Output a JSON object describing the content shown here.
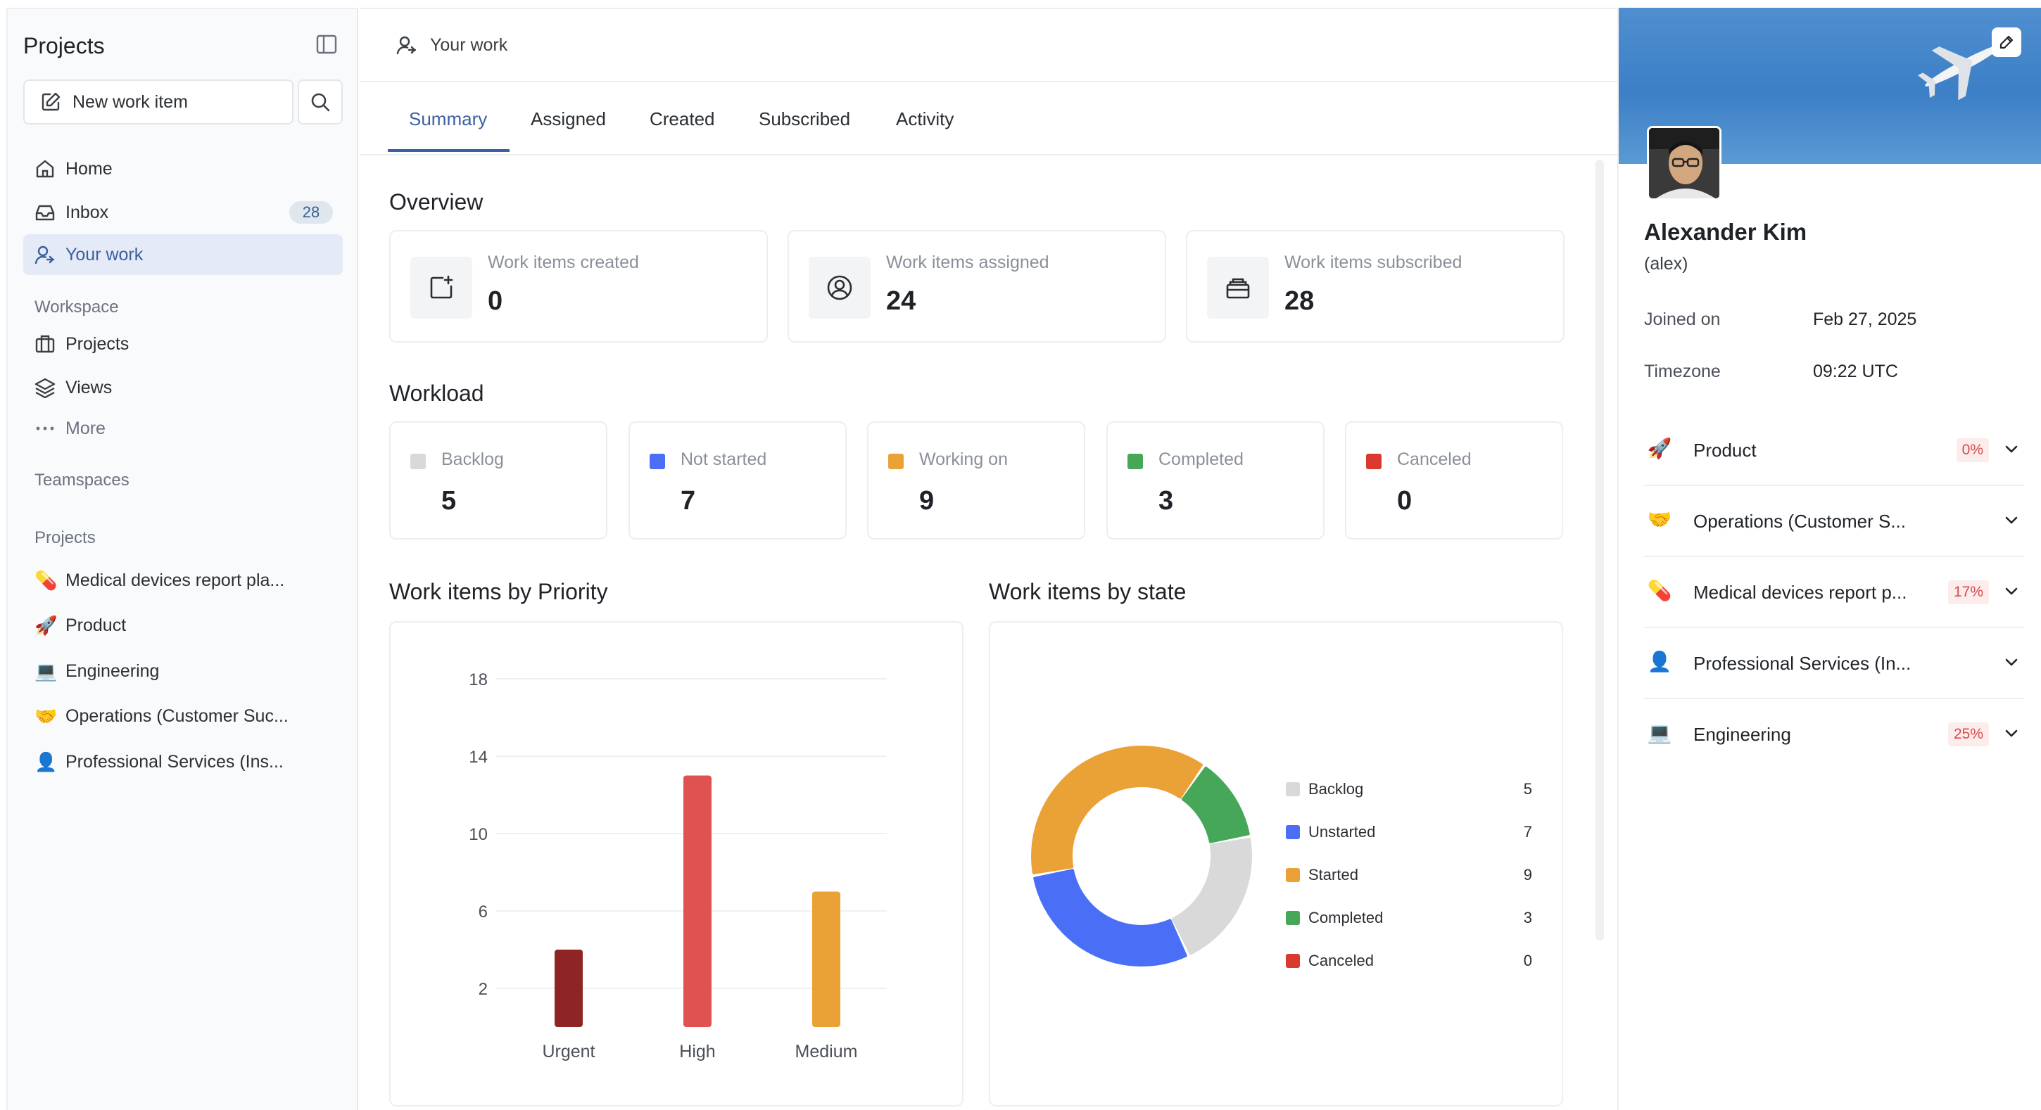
{
  "sidebar": {
    "title": "Projects",
    "new_item_label": "New work item",
    "nav": [
      {
        "label": "Home",
        "icon": "home-icon"
      },
      {
        "label": "Inbox",
        "icon": "inbox-icon",
        "badge": "28"
      },
      {
        "label": "Your work",
        "icon": "user-work-icon",
        "active": true
      }
    ],
    "workspace_label": "Workspace",
    "workspace_items": [
      {
        "label": "Projects",
        "icon": "briefcase-icon"
      },
      {
        "label": "Views",
        "icon": "layers-icon"
      },
      {
        "label": "More",
        "icon": "more-icon"
      }
    ],
    "teamspaces_label": "Teamspaces",
    "projects_label": "Projects",
    "projects": [
      {
        "emoji": "💊",
        "label": "Medical devices report pla..."
      },
      {
        "emoji": "🚀",
        "label": "Product"
      },
      {
        "emoji": "💻",
        "label": "Engineering"
      },
      {
        "emoji": "🤝",
        "label": "Operations (Customer Suc..."
      },
      {
        "emoji": "👤",
        "label": "Professional Services (Ins..."
      }
    ]
  },
  "header": {
    "title": "Your work",
    "tabs": [
      {
        "label": "Summary",
        "active": true
      },
      {
        "label": "Assigned"
      },
      {
        "label": "Created"
      },
      {
        "label": "Subscribed"
      },
      {
        "label": "Activity"
      }
    ]
  },
  "overview": {
    "title": "Overview",
    "cards": [
      {
        "label": "Work items created",
        "value": "0",
        "icon": "file-plus-icon"
      },
      {
        "label": "Work items assigned",
        "value": "24",
        "icon": "user-circle-icon"
      },
      {
        "label": "Work items subscribed",
        "value": "28",
        "icon": "briefcase-stack-icon"
      }
    ]
  },
  "workload": {
    "title": "Workload",
    "items": [
      {
        "label": "Backlog",
        "value": "5",
        "color": "#d9d9d9"
      },
      {
        "label": "Not started",
        "value": "7",
        "color": "#4a6ef5"
      },
      {
        "label": "Working on",
        "value": "9",
        "color": "#eaa237"
      },
      {
        "label": "Completed",
        "value": "3",
        "color": "#46a758"
      },
      {
        "label": "Canceled",
        "value": "0",
        "color": "#d9392f"
      }
    ]
  },
  "priority_chart_title": "Work items by Priority",
  "state_chart_title": "Work items by state",
  "chart_data": [
    {
      "type": "bar",
      "title": "Work items by Priority",
      "categories": [
        "Urgent",
        "High",
        "Medium"
      ],
      "values": [
        4,
        13,
        7
      ],
      "colors": [
        "#8e2424",
        "#e05252",
        "#eaa237"
      ],
      "yticks": [
        2,
        6,
        10,
        14,
        18
      ],
      "ylim": [
        0,
        18
      ]
    },
    {
      "type": "pie",
      "title": "Work items by state",
      "labels": [
        "Backlog",
        "Unstarted",
        "Started",
        "Completed",
        "Canceled"
      ],
      "values": [
        5,
        7,
        9,
        3,
        0
      ],
      "colors": [
        "#d9d9d9",
        "#4a6ef5",
        "#eaa237",
        "#46a758",
        "#d9392f"
      ]
    }
  ],
  "profile": {
    "name": "Alexander Kim",
    "username": "(alex)",
    "joined_label": "Joined on",
    "joined_value": "Feb 27, 2025",
    "timezone_label": "Timezone",
    "timezone_value": "09:22 UTC",
    "projects": [
      {
        "emoji": "🚀",
        "label": "Product",
        "pct": "0%"
      },
      {
        "emoji": "🤝",
        "label": "Operations (Customer S..."
      },
      {
        "emoji": "💊",
        "label": "Medical devices report p...",
        "pct": "17%"
      },
      {
        "emoji": "👤",
        "label": "Professional Services (In..."
      },
      {
        "emoji": "💻",
        "label": "Engineering",
        "pct": "25%"
      }
    ]
  }
}
